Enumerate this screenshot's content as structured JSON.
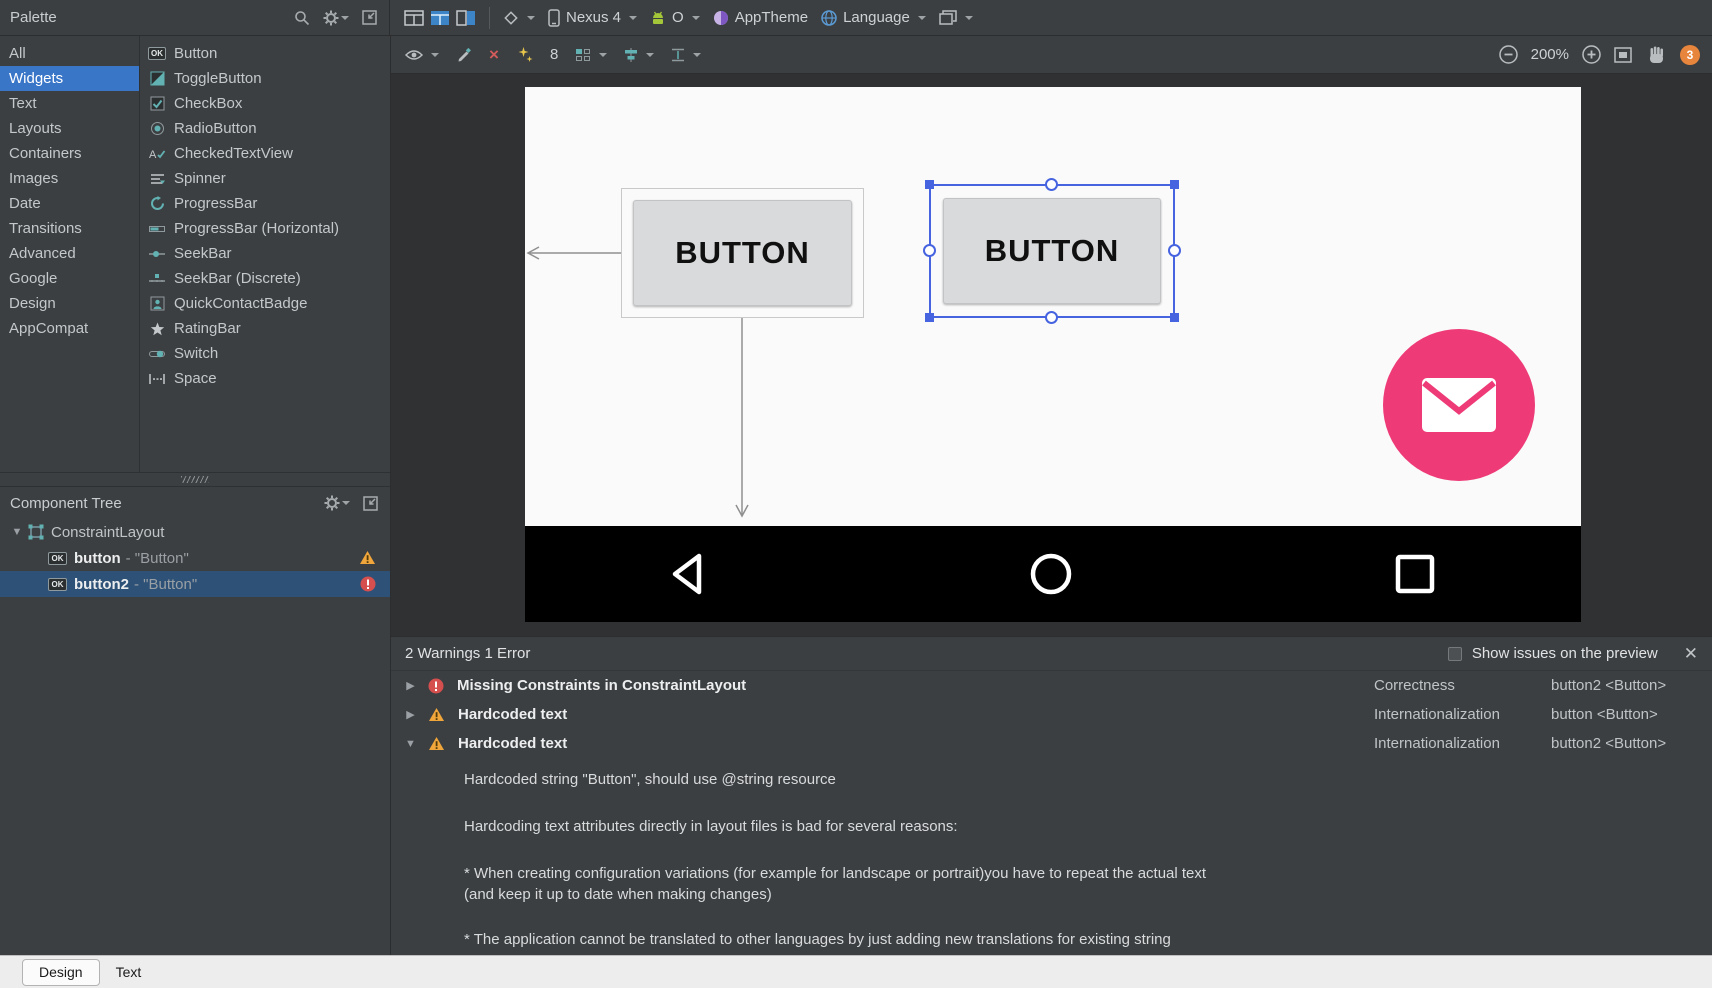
{
  "top_toolbar": {
    "palette_title": "Palette",
    "device_label": "Nexus 4",
    "api_label": "O",
    "theme_label": "AppTheme",
    "language_label": "Language"
  },
  "canvas_toolbar": {
    "default_margin": "8",
    "zoom_level": "200%",
    "issue_count": "3"
  },
  "palette": {
    "categories": [
      "All",
      "Widgets",
      "Text",
      "Layouts",
      "Containers",
      "Images",
      "Date",
      "Transitions",
      "Advanced",
      "Google",
      "Design",
      "AppCompat"
    ],
    "widgets": [
      "Button",
      "ToggleButton",
      "CheckBox",
      "RadioButton",
      "CheckedTextView",
      "Spinner",
      "ProgressBar",
      "ProgressBar (Horizontal)",
      "SeekBar",
      "SeekBar (Discrete)",
      "QuickContactBadge",
      "RatingBar",
      "Switch",
      "Space"
    ]
  },
  "component_tree": {
    "title": "Component Tree",
    "root_label": "ConstraintLayout",
    "items": [
      {
        "name": "button",
        "suffix": "- \"Button\""
      },
      {
        "name": "button2",
        "suffix": "- \"Button\""
      }
    ]
  },
  "canvas": {
    "button1_label": "BUTTON",
    "button2_label": "BUTTON"
  },
  "issues": {
    "header": "2 Warnings 1 Error",
    "show_on_preview_label": "Show issues on the preview",
    "rows": [
      {
        "arrow": "▶",
        "title": "Missing Constraints in ConstraintLayout",
        "category": "Correctness",
        "component": "button2 <Button>"
      },
      {
        "arrow": "▶",
        "title": "Hardcoded text",
        "category": "Internationalization",
        "component": "button <Button>"
      },
      {
        "arrow": "▼",
        "title": "Hardcoded text",
        "category": "Internationalization",
        "component": "button2 <Button>"
      }
    ],
    "detail": {
      "p1": "Hardcoded string \"Button\", should use @string resource",
      "p2": "Hardcoding text attributes directly in layout files is bad for several reasons:",
      "p3": "* When creating configuration variations (for example for landscape or portrait)you have to repeat the actual text\n(and keep it up to date when making changes)",
      "p4": "* The application cannot be translated to other languages by just adding new translations for existing string"
    }
  },
  "bottom_tabs": [
    "Design",
    "Text"
  ]
}
